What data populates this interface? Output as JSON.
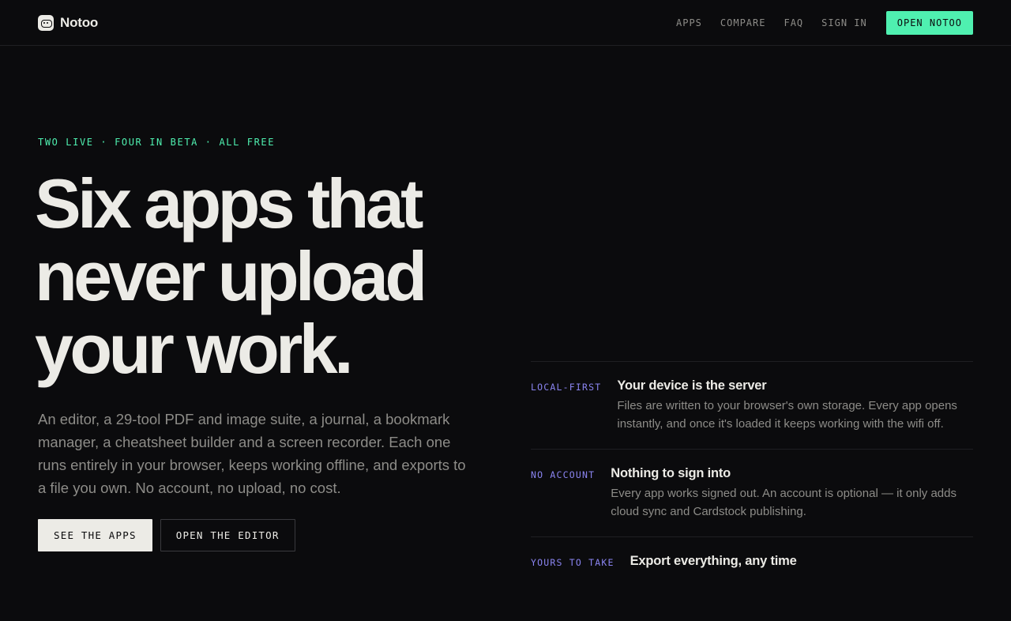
{
  "brand": {
    "name": "Notoo",
    "logo_icon": "notoo-logo-icon"
  },
  "nav": {
    "links": [
      {
        "label": "APPS"
      },
      {
        "label": "COMPARE"
      },
      {
        "label": "FAQ"
      },
      {
        "label": "SIGN IN"
      }
    ],
    "cta": "OPEN NOTOO"
  },
  "hero": {
    "eyebrow": "TWO LIVE · FOUR IN BETA · ALL FREE",
    "headline_lines": [
      "Six apps that",
      "never upload",
      "your work."
    ],
    "lede": "An editor, a 29-tool PDF and image suite, a journal, a bookmark manager, a cheatsheet builder and a screen recorder. Each one runs entirely in your browser, keeps working offline, and exports to a file you own. No account, no upload, no cost.",
    "primary_button": "SEE THE APPS",
    "secondary_button": "OPEN THE EDITOR"
  },
  "features": [
    {
      "tag": "LOCAL-FIRST",
      "title": "Your device is the server",
      "desc": "Files are written to your browser's own storage. Every app opens instantly, and once it's loaded it keeps working with the wifi off."
    },
    {
      "tag": "NO ACCOUNT",
      "title": "Nothing to sign into",
      "desc": "Every app works signed out. An account is optional — it only adds cloud sync and Cardstock publishing."
    },
    {
      "tag": "YOURS TO TAKE",
      "title": "Export everything, any time",
      "desc": ""
    }
  ],
  "colors": {
    "background": "#0b0b0d",
    "accent_green": "#4ff0b0",
    "accent_purple": "#8a84f0",
    "text": "#ecebe6",
    "muted": "#8d8c88"
  }
}
